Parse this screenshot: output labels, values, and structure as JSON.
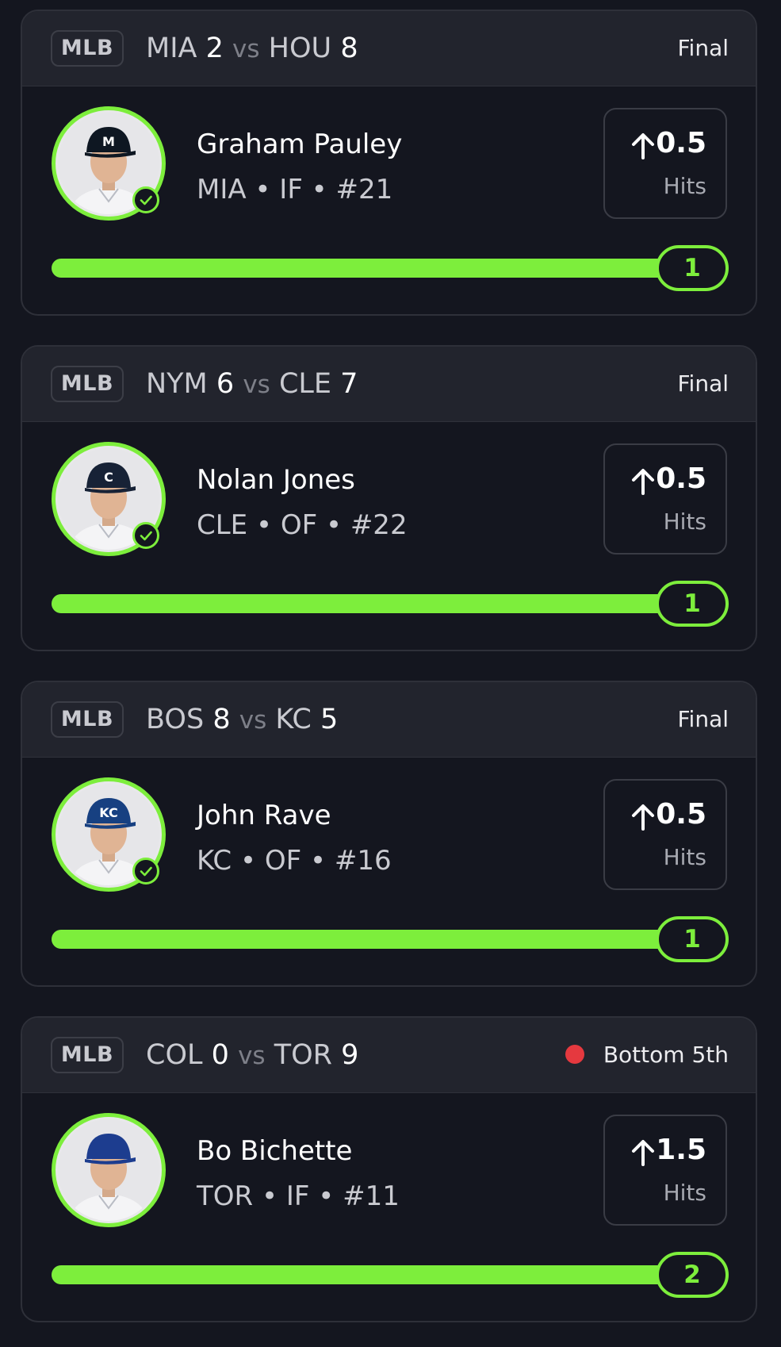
{
  "colors": {
    "background": "#14161f",
    "header": "#22242d",
    "accent_green": "#7dee3c",
    "live_red": "#e5393f"
  },
  "cards": [
    {
      "league": "MLB",
      "away_team": "MIA",
      "away_score": "2",
      "vs": "vs",
      "home_team": "HOU",
      "home_score": "8",
      "status": "Final",
      "live": false,
      "player_name": "Graham Pauley",
      "player_meta": "MIA • IF • #21",
      "verified": true,
      "direction_icon": "arrow-up-icon",
      "line_value": "0.5",
      "line_stat": "Hits",
      "progress_count": "1",
      "progress_fraction": 1.0,
      "cap_color": "#0e1722",
      "cap_logo": "M"
    },
    {
      "league": "MLB",
      "away_team": "NYM",
      "away_score": "6",
      "vs": "vs",
      "home_team": "CLE",
      "home_score": "7",
      "status": "Final",
      "live": false,
      "player_name": "Nolan Jones",
      "player_meta": "CLE • OF • #22",
      "verified": true,
      "direction_icon": "arrow-up-icon",
      "line_value": "0.5",
      "line_stat": "Hits",
      "progress_count": "1",
      "progress_fraction": 1.0,
      "cap_color": "#172236",
      "cap_logo": "C"
    },
    {
      "league": "MLB",
      "away_team": "BOS",
      "away_score": "8",
      "vs": "vs",
      "home_team": "KC",
      "home_score": "5",
      "status": "Final",
      "live": false,
      "player_name": "John Rave",
      "player_meta": "KC • OF • #16",
      "verified": true,
      "direction_icon": "arrow-up-icon",
      "line_value": "0.5",
      "line_stat": "Hits",
      "progress_count": "1",
      "progress_fraction": 1.0,
      "cap_color": "#174081",
      "cap_logo": "KC"
    },
    {
      "league": "MLB",
      "away_team": "COL",
      "away_score": "0",
      "vs": "vs",
      "home_team": "TOR",
      "home_score": "9",
      "status": "Bottom 5th",
      "live": true,
      "player_name": "Bo Bichette",
      "player_meta": "TOR • IF • #11",
      "verified": false,
      "direction_icon": "arrow-up-icon",
      "line_value": "1.5",
      "line_stat": "Hits",
      "progress_count": "2",
      "progress_fraction": 1.0,
      "cap_color": "#1d3d8f",
      "cap_logo": ""
    }
  ]
}
